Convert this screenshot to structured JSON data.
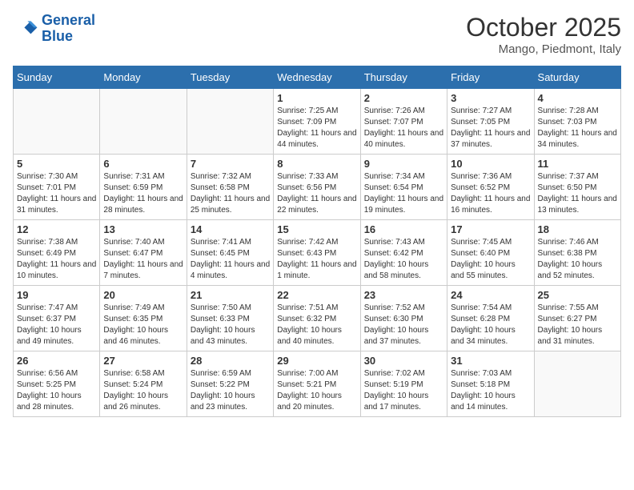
{
  "header": {
    "logo_line1": "General",
    "logo_line2": "Blue",
    "month_title": "October 2025",
    "location": "Mango, Piedmont, Italy"
  },
  "weekdays": [
    "Sunday",
    "Monday",
    "Tuesday",
    "Wednesday",
    "Thursday",
    "Friday",
    "Saturday"
  ],
  "weeks": [
    [
      {
        "day": "",
        "info": ""
      },
      {
        "day": "",
        "info": ""
      },
      {
        "day": "",
        "info": ""
      },
      {
        "day": "1",
        "info": "Sunrise: 7:25 AM\nSunset: 7:09 PM\nDaylight: 11 hours and 44 minutes."
      },
      {
        "day": "2",
        "info": "Sunrise: 7:26 AM\nSunset: 7:07 PM\nDaylight: 11 hours and 40 minutes."
      },
      {
        "day": "3",
        "info": "Sunrise: 7:27 AM\nSunset: 7:05 PM\nDaylight: 11 hours and 37 minutes."
      },
      {
        "day": "4",
        "info": "Sunrise: 7:28 AM\nSunset: 7:03 PM\nDaylight: 11 hours and 34 minutes."
      }
    ],
    [
      {
        "day": "5",
        "info": "Sunrise: 7:30 AM\nSunset: 7:01 PM\nDaylight: 11 hours and 31 minutes."
      },
      {
        "day": "6",
        "info": "Sunrise: 7:31 AM\nSunset: 6:59 PM\nDaylight: 11 hours and 28 minutes."
      },
      {
        "day": "7",
        "info": "Sunrise: 7:32 AM\nSunset: 6:58 PM\nDaylight: 11 hours and 25 minutes."
      },
      {
        "day": "8",
        "info": "Sunrise: 7:33 AM\nSunset: 6:56 PM\nDaylight: 11 hours and 22 minutes."
      },
      {
        "day": "9",
        "info": "Sunrise: 7:34 AM\nSunset: 6:54 PM\nDaylight: 11 hours and 19 minutes."
      },
      {
        "day": "10",
        "info": "Sunrise: 7:36 AM\nSunset: 6:52 PM\nDaylight: 11 hours and 16 minutes."
      },
      {
        "day": "11",
        "info": "Sunrise: 7:37 AM\nSunset: 6:50 PM\nDaylight: 11 hours and 13 minutes."
      }
    ],
    [
      {
        "day": "12",
        "info": "Sunrise: 7:38 AM\nSunset: 6:49 PM\nDaylight: 11 hours and 10 minutes."
      },
      {
        "day": "13",
        "info": "Sunrise: 7:40 AM\nSunset: 6:47 PM\nDaylight: 11 hours and 7 minutes."
      },
      {
        "day": "14",
        "info": "Sunrise: 7:41 AM\nSunset: 6:45 PM\nDaylight: 11 hours and 4 minutes."
      },
      {
        "day": "15",
        "info": "Sunrise: 7:42 AM\nSunset: 6:43 PM\nDaylight: 11 hours and 1 minute."
      },
      {
        "day": "16",
        "info": "Sunrise: 7:43 AM\nSunset: 6:42 PM\nDaylight: 10 hours and 58 minutes."
      },
      {
        "day": "17",
        "info": "Sunrise: 7:45 AM\nSunset: 6:40 PM\nDaylight: 10 hours and 55 minutes."
      },
      {
        "day": "18",
        "info": "Sunrise: 7:46 AM\nSunset: 6:38 PM\nDaylight: 10 hours and 52 minutes."
      }
    ],
    [
      {
        "day": "19",
        "info": "Sunrise: 7:47 AM\nSunset: 6:37 PM\nDaylight: 10 hours and 49 minutes."
      },
      {
        "day": "20",
        "info": "Sunrise: 7:49 AM\nSunset: 6:35 PM\nDaylight: 10 hours and 46 minutes."
      },
      {
        "day": "21",
        "info": "Sunrise: 7:50 AM\nSunset: 6:33 PM\nDaylight: 10 hours and 43 minutes."
      },
      {
        "day": "22",
        "info": "Sunrise: 7:51 AM\nSunset: 6:32 PM\nDaylight: 10 hours and 40 minutes."
      },
      {
        "day": "23",
        "info": "Sunrise: 7:52 AM\nSunset: 6:30 PM\nDaylight: 10 hours and 37 minutes."
      },
      {
        "day": "24",
        "info": "Sunrise: 7:54 AM\nSunset: 6:28 PM\nDaylight: 10 hours and 34 minutes."
      },
      {
        "day": "25",
        "info": "Sunrise: 7:55 AM\nSunset: 6:27 PM\nDaylight: 10 hours and 31 minutes."
      }
    ],
    [
      {
        "day": "26",
        "info": "Sunrise: 6:56 AM\nSunset: 5:25 PM\nDaylight: 10 hours and 28 minutes."
      },
      {
        "day": "27",
        "info": "Sunrise: 6:58 AM\nSunset: 5:24 PM\nDaylight: 10 hours and 26 minutes."
      },
      {
        "day": "28",
        "info": "Sunrise: 6:59 AM\nSunset: 5:22 PM\nDaylight: 10 hours and 23 minutes."
      },
      {
        "day": "29",
        "info": "Sunrise: 7:00 AM\nSunset: 5:21 PM\nDaylight: 10 hours and 20 minutes."
      },
      {
        "day": "30",
        "info": "Sunrise: 7:02 AM\nSunset: 5:19 PM\nDaylight: 10 hours and 17 minutes."
      },
      {
        "day": "31",
        "info": "Sunrise: 7:03 AM\nSunset: 5:18 PM\nDaylight: 10 hours and 14 minutes."
      },
      {
        "day": "",
        "info": ""
      }
    ]
  ]
}
